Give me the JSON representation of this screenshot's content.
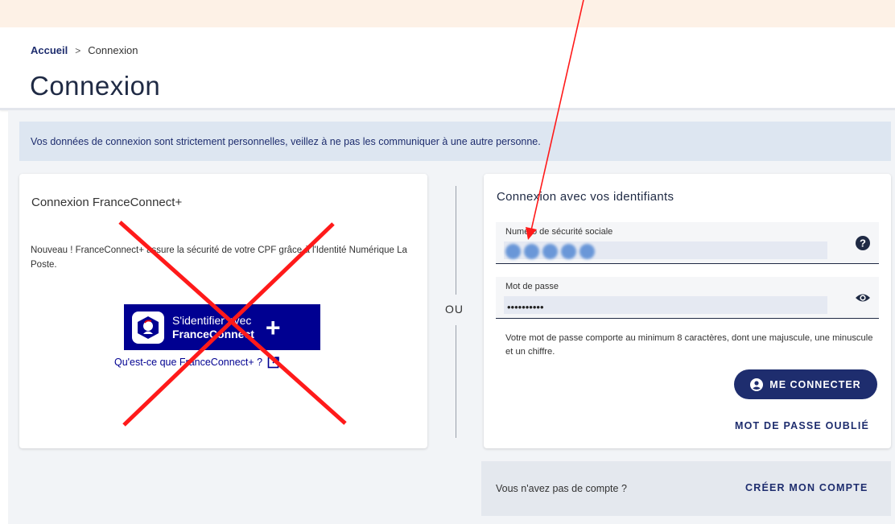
{
  "breadcrumb": {
    "home": "Accueil",
    "separator": ">",
    "current": "Connexion"
  },
  "page_title": "Connexion",
  "info_banner": "Vos données de connexion sont strictement personnelles, veillez à ne pas les communiquer à une autre personne.",
  "franceconnect": {
    "title": "Connexion FranceConnect+",
    "description": "Nouveau ! FranceConnect+ assure la sécurité de votre CPF grâce à l'Identité Numérique La Poste.",
    "button_line1": "S'identifier avec",
    "button_line2": "FranceConnect",
    "button_plus": "+",
    "link": "Qu'est-ce que FranceConnect+ ?",
    "crossed_out": true,
    "cross_color": "#ff1a1a"
  },
  "separator_label": "OU",
  "identifiants": {
    "title": "Connexion avec vos identifiants",
    "ssn_label": "Numéro de sécurité sociale",
    "ssn_value_blurred": true,
    "password_label": "Mot de passe",
    "password_mask": "••••••••••",
    "password_help": "Votre mot de passe comporte au minimum 8 caractères, dont une majuscule, une minuscule et un chiffre.",
    "connect_button": "ME CONNECTER",
    "forgot_link": "MOT DE PASSE OUBLIÉ"
  },
  "account": {
    "question": "Vous n'avez pas de compte ?",
    "create_link": "CRÉER MON COMPTE"
  },
  "icons": [
    "help-icon",
    "eye-icon",
    "user-icon",
    "external-link-icon",
    "franceconnect-logo-icon"
  ],
  "colors": {
    "primary": "#1e2d6e",
    "franceconnect": "#000091",
    "annotation_red": "#ff1a1a",
    "banner": "#dde6f1"
  }
}
